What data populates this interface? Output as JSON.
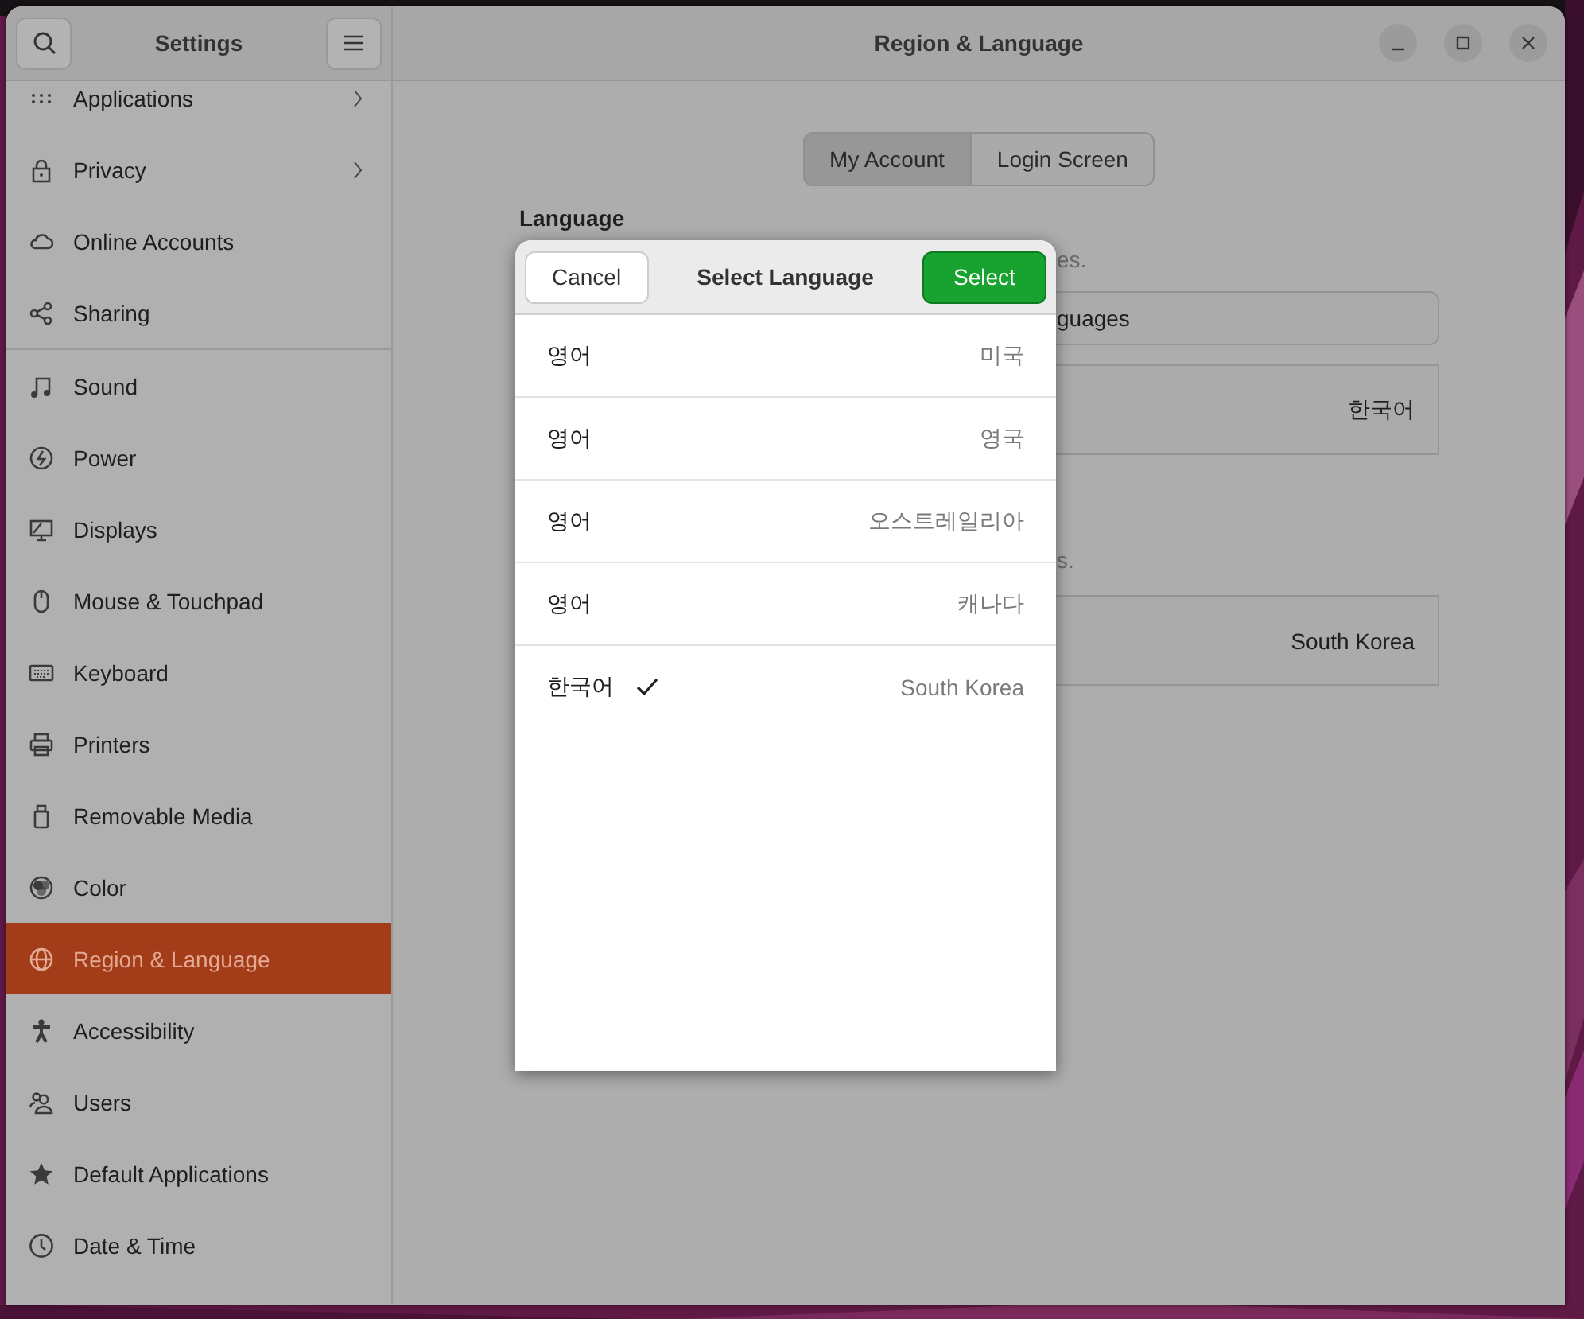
{
  "sidebar": {
    "title": "Settings",
    "items": [
      {
        "label": "Applications",
        "selected": false,
        "submenu": true,
        "divider_before": false
      },
      {
        "label": "Privacy",
        "selected": false,
        "submenu": true,
        "divider_before": false
      },
      {
        "label": "Online Accounts",
        "selected": false,
        "submenu": false,
        "divider_before": false
      },
      {
        "label": "Sharing",
        "selected": false,
        "submenu": false,
        "divider_before": false
      },
      {
        "label": "Sound",
        "selected": false,
        "submenu": false,
        "divider_before": true
      },
      {
        "label": "Power",
        "selected": false,
        "submenu": false,
        "divider_before": false
      },
      {
        "label": "Displays",
        "selected": false,
        "submenu": false,
        "divider_before": false
      },
      {
        "label": "Mouse & Touchpad",
        "selected": false,
        "submenu": false,
        "divider_before": false
      },
      {
        "label": "Keyboard",
        "selected": false,
        "submenu": false,
        "divider_before": false
      },
      {
        "label": "Printers",
        "selected": false,
        "submenu": false,
        "divider_before": false
      },
      {
        "label": "Removable Media",
        "selected": false,
        "submenu": false,
        "divider_before": false
      },
      {
        "label": "Color",
        "selected": false,
        "submenu": false,
        "divider_before": false
      },
      {
        "label": "Region & Language",
        "selected": true,
        "submenu": false,
        "divider_before": false
      },
      {
        "label": "Accessibility",
        "selected": false,
        "submenu": false,
        "divider_before": false
      },
      {
        "label": "Users",
        "selected": false,
        "submenu": false,
        "divider_before": false
      },
      {
        "label": "Default Applications",
        "selected": false,
        "submenu": false,
        "divider_before": false
      },
      {
        "label": "Date & Time",
        "selected": false,
        "submenu": false,
        "divider_before": false
      }
    ]
  },
  "page": {
    "title": "Region & Language",
    "tabs": [
      {
        "label": "My Account",
        "selected": true
      },
      {
        "label": "Login Screen",
        "selected": false
      }
    ],
    "language_heading": "Language",
    "language_hint": "es.",
    "languages_field": "guages",
    "language_value": "한국어",
    "formats_hint": "s.",
    "formats_value": "South Korea"
  },
  "dialog": {
    "title": "Select Language",
    "cancel": "Cancel",
    "select": "Select",
    "languages": [
      {
        "language": "영어",
        "country": "미국",
        "selected": false
      },
      {
        "language": "영어",
        "country": "영국",
        "selected": false
      },
      {
        "language": "영어",
        "country": "오스트레일리아",
        "selected": false
      },
      {
        "language": "영어",
        "country": "캐나다",
        "selected": false
      },
      {
        "language": "한국어",
        "country": "South Korea",
        "selected": true
      }
    ]
  }
}
